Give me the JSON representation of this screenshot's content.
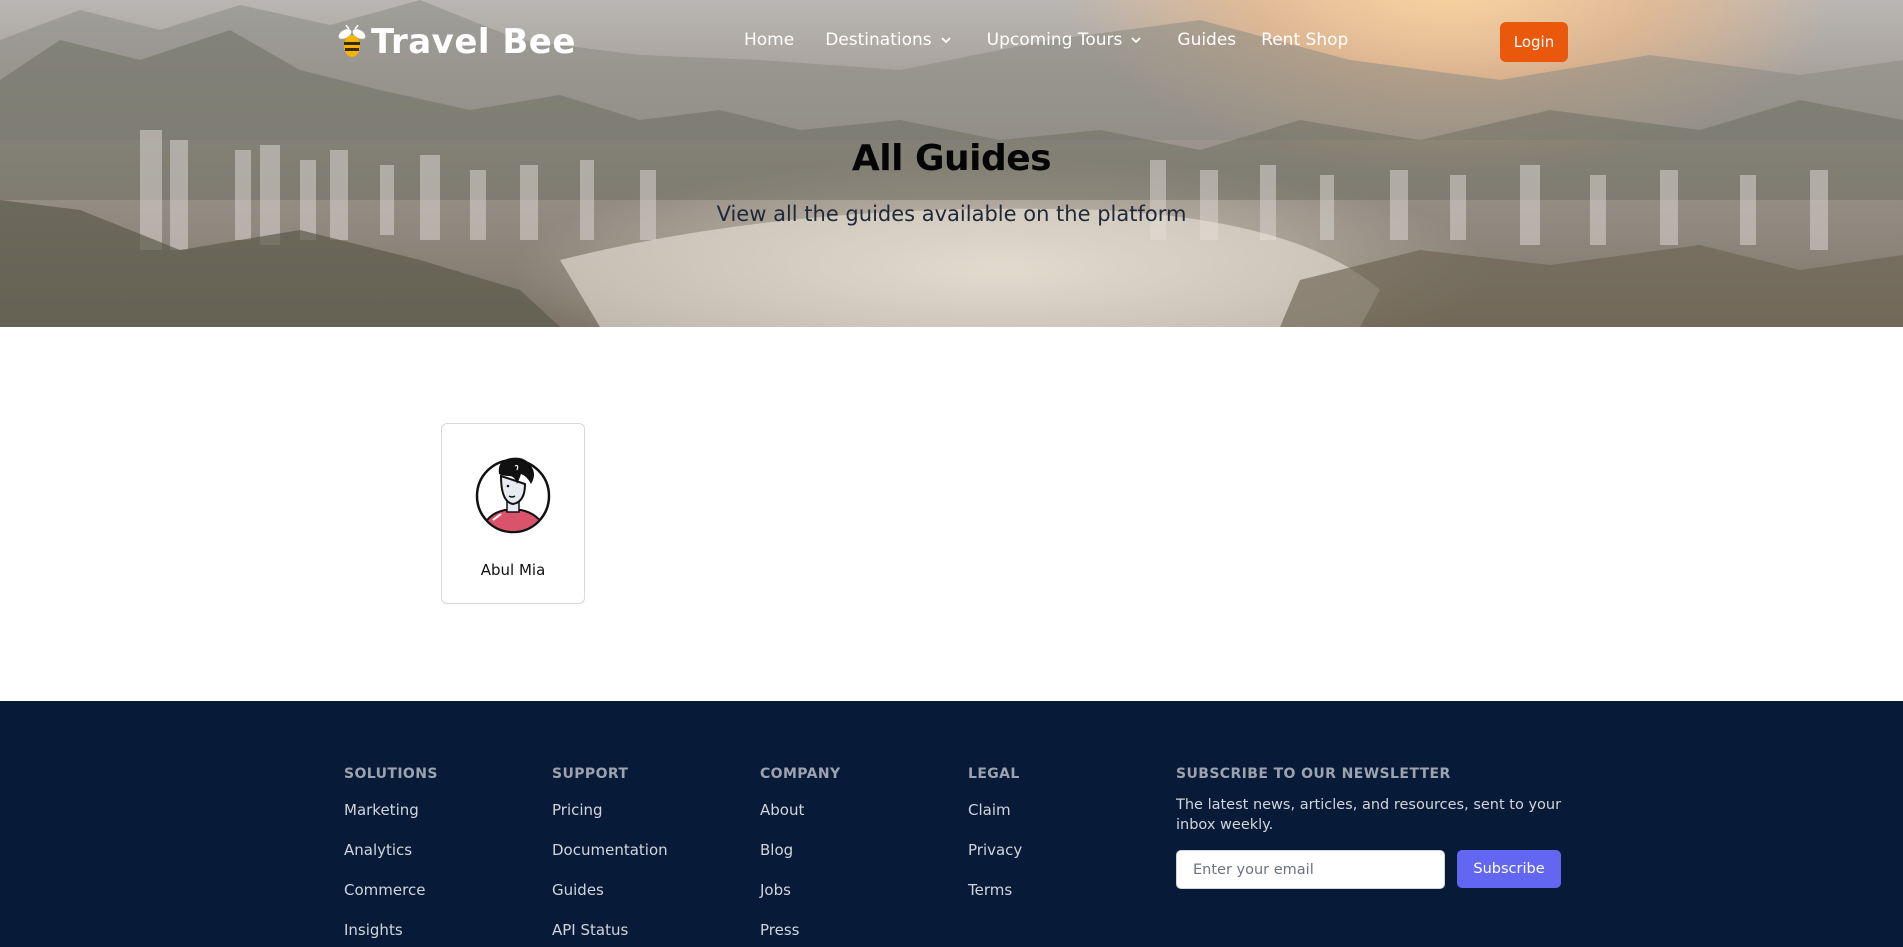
{
  "header": {
    "brand": "Travel Bee",
    "logo_icon": "bee-icon",
    "nav": [
      {
        "label": "Home"
      },
      {
        "label": "Destinations",
        "has_dropdown": true
      },
      {
        "label": "Upcoming Tours",
        "has_dropdown": true
      },
      {
        "label": "Guides"
      },
      {
        "label": "Rent Shop"
      }
    ],
    "login_label": "Login"
  },
  "hero": {
    "title": "All Guides",
    "subtitle": "View all the guides available on the platform"
  },
  "guides": [
    {
      "name": "Abul Mia",
      "avatar_icon": "person-avatar-icon"
    }
  ],
  "footer": {
    "columns": [
      {
        "title": "SOLUTIONS",
        "links": [
          "Marketing",
          "Analytics",
          "Commerce",
          "Insights"
        ]
      },
      {
        "title": "SUPPORT",
        "links": [
          "Pricing",
          "Documentation",
          "Guides",
          "API Status"
        ]
      },
      {
        "title": "COMPANY",
        "links": [
          "About",
          "Blog",
          "Jobs",
          "Press"
        ]
      },
      {
        "title": "LEGAL",
        "links": [
          "Claim",
          "Privacy",
          "Terms"
        ]
      }
    ],
    "newsletter": {
      "title": "SUBSCRIBE TO OUR NEWSLETTER",
      "description": "The latest news, articles, and resources, sent to your inbox weekly.",
      "placeholder": "Enter your email",
      "button_label": "Subscribe"
    }
  },
  "colors": {
    "accent_login": "#ea580c",
    "accent_subscribe": "#6366f1",
    "footer_bg": "#071a37"
  }
}
